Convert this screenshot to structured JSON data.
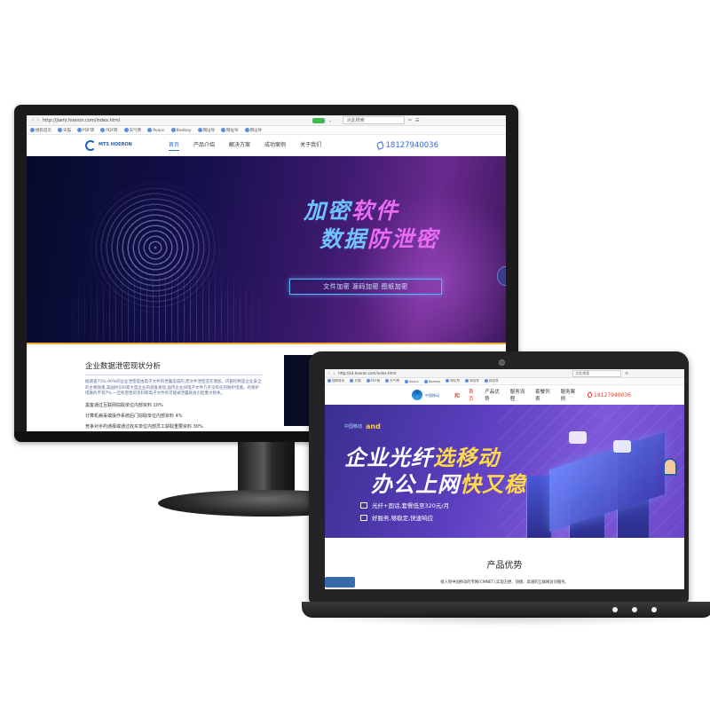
{
  "monitor": {
    "browser": {
      "url": "http://jiami.hoeron.com/index.html",
      "search_placeholder": "点此搜索",
      "bookmarks": [
        "搜狗首页",
        "天猫",
        "PDF转",
        "PDF转",
        "天气预",
        "Avanc",
        "Beeboy",
        "网址导",
        "网址导",
        "网址导"
      ]
    },
    "site": {
      "logo_text": "MTS HOERON",
      "nav": [
        "首页",
        "产品介绍",
        "解决方案",
        "成功案例",
        "关于我们"
      ],
      "phone": "18127940036"
    },
    "hero": {
      "line1_a": "加密",
      "line1_b": "软件",
      "line2_a": "数据",
      "line2_b": "防泄密",
      "tags": "文件加密   源码加密   图纸加密"
    },
    "content": {
      "heading": "企业数据泄密现状分析",
      "paragraph": "据调查75%-90%的企业泄密是由电子文件的泄露造成的,而文件泄密还在增加。内部控制是企业安全的主要隐患,美国约500家大型企业的调查发现,国内企业同电子文件几乎没有任何防护措施。有保护措施的不到7%,一旦机密性的资料和电子文件有可能被泄露就会引起重大损失。",
      "lines": [
        "黑客通过互联网窃取单位内部资料 10%",
        "计算机病毒或操作系统后门窃取单位内部资料 4%",
        "竞争对手的通报或通过收买单位内部员工获取重要资料 30%"
      ]
    }
  },
  "laptop": {
    "browser": {
      "url": "http://kd.hoeron.com/index.html",
      "search_placeholder": "点此搜索",
      "bookmarks": [
        "搜狗首页",
        "天猫",
        "PDF转",
        "天气预",
        "Avanc",
        "Beeboy",
        "网址导",
        "网址导",
        "网址导"
      ]
    },
    "site": {
      "logo_text": "中国移动",
      "logo_hello": "和",
      "nav": [
        "首页",
        "产品优势",
        "服务流程",
        "套餐列表",
        "服务案例"
      ],
      "phone": "18127940036"
    },
    "hero": {
      "brand_left": "中国移动",
      "brand_and": "and",
      "line1_a": "企业光纤",
      "line1_b": "选移动",
      "line2_a": "办公上网",
      "line2_b": "快又稳",
      "feature1": "光纤+固话,套餐低至320元/月",
      "feature2": "好服务,够稳定,快速响应"
    },
    "content": {
      "heading": "产品优势",
      "desc": "接入到中国移动的专网(CMNET),实现方便、快捷、高速的互联网访问服务。"
    }
  }
}
